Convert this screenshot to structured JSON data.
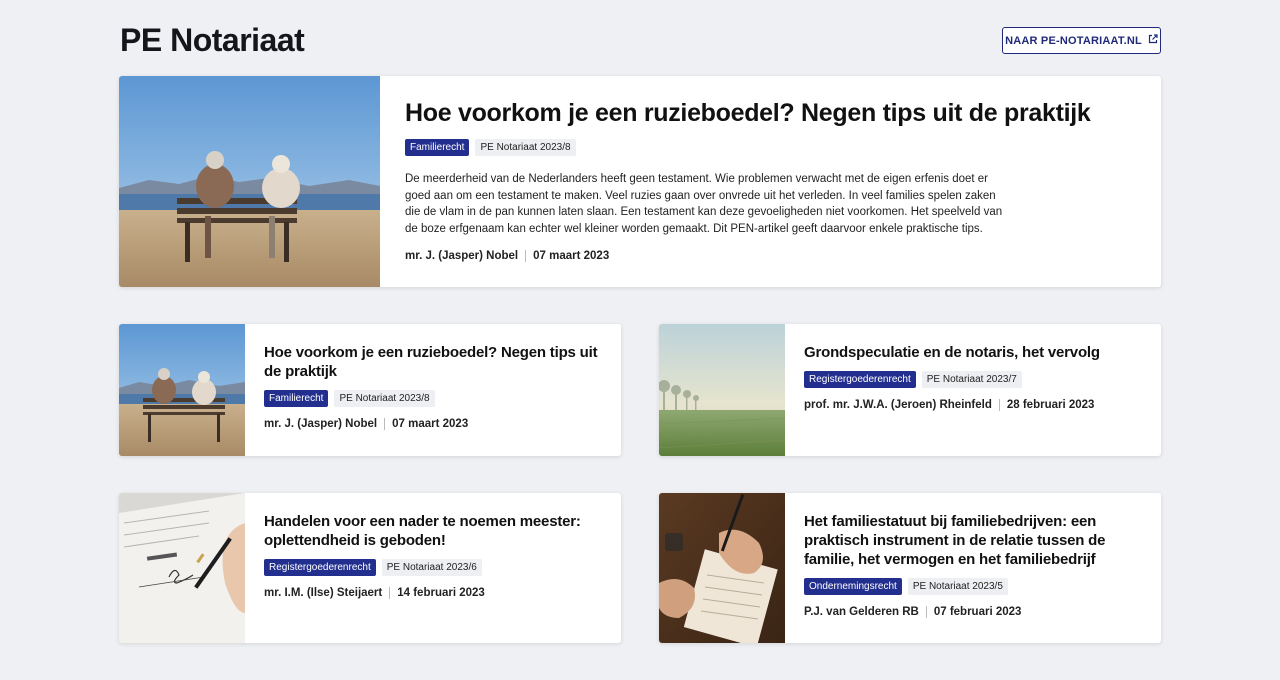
{
  "header": {
    "title": "PE Notariaat",
    "site_link_label": "NAAR PE-NOTARIAAT.NL",
    "site_link_icon": "external-link-icon"
  },
  "colors": {
    "accent": "#232f8f",
    "background": "#eef0f4"
  },
  "featured": {
    "title": "Hoe voorkom je een ruzieboedel? Negen tips uit de praktijk",
    "category": "Familierecht",
    "issue": "PE Notariaat 2023/8",
    "summary": "De meerderheid van de Nederlanders heeft geen testament. Wie problemen verwacht met de eigen erfenis doet er goed aan om een testament te maken. Veel ruzies gaan over onvrede uit het verleden. In veel families spelen zaken die de vlam in de pan kunnen laten slaan. Een testament kan deze gevoeligheden niet voorkomen. Het speelveld van de boze erfgenaam kan echter wel kleiner worden gemaakt. Dit PEN-artikel geeft daarvoor enkele praktische tips.",
    "author": "mr. J. (Jasper) Nobel",
    "date": "07 maart 2023",
    "image": "elderly-couple-bench-photo"
  },
  "articles": [
    {
      "title": "Hoe voorkom je een ruzieboedel? Negen tips uit de praktijk",
      "category": "Familierecht",
      "issue": "PE Notariaat 2023/8",
      "author": "mr. J. (Jasper) Nobel",
      "date": "07 maart 2023",
      "image": "elderly-couple-bench-photo"
    },
    {
      "title": "Grondspeculatie en de notaris, het vervolg",
      "category": "Registergoederenrecht",
      "issue": "PE Notariaat 2023/7",
      "author": "prof. mr. J.W.A. (Jeroen) Rheinfeld",
      "date": "28 februari 2023",
      "image": "misty-field-photo"
    },
    {
      "title": "Handelen voor een nader te noemen meester: oplettendheid is geboden!",
      "category": "Registergoederenrecht",
      "issue": "PE Notariaat 2023/6",
      "author": "mr. I.M. (Ilse) Steijaert",
      "date": "14 februari 2023",
      "image": "signing-document-photo"
    },
    {
      "title": "Het familiestatuut bij familiebedrijven: een praktisch instrument in de relatie tussen de familie, het vermogen en het familiebedrijf",
      "category": "Ondernemingsrecht",
      "issue": "PE Notariaat 2023/5",
      "author": "P.J. van Gelderen RB",
      "date": "07 februari 2023",
      "image": "hands-writing-photo"
    }
  ]
}
